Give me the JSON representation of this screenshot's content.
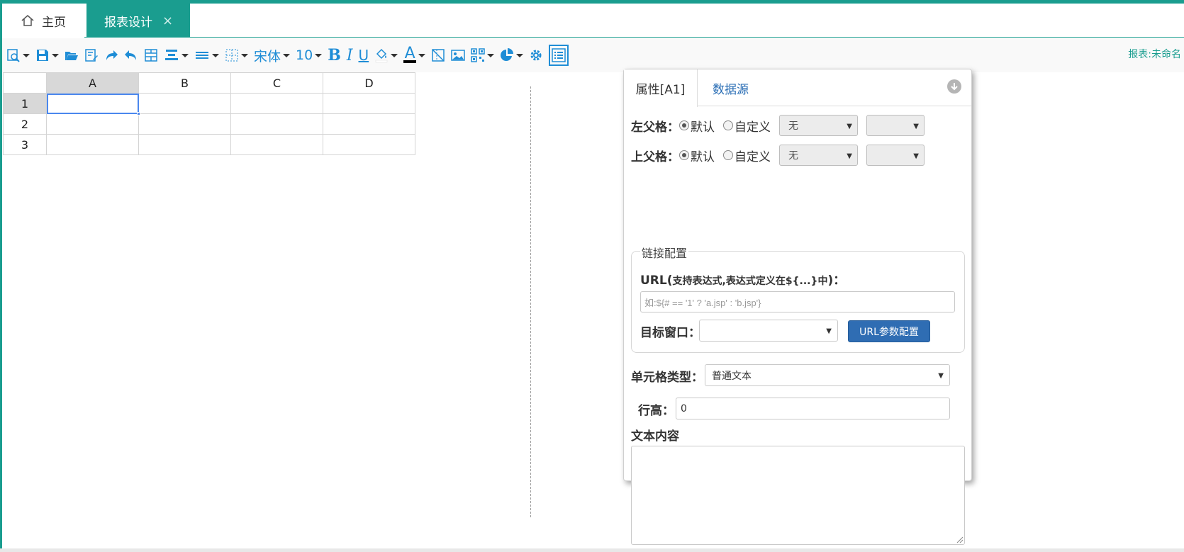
{
  "tabs": {
    "home": "主页",
    "design": "报表设计",
    "close": "×"
  },
  "toolbar": {
    "font_name": "宋体",
    "font_size": "10",
    "bold": "B",
    "italic": "I",
    "underline": "U",
    "font_color_letter": "A",
    "report_name": "报表:未命名",
    "accent_color": "#1f8dd6"
  },
  "sheet": {
    "columns": [
      "A",
      "B",
      "C",
      "D"
    ],
    "rows": [
      "1",
      "2",
      "3"
    ],
    "selected_cell": "A1"
  },
  "panel": {
    "tabs": {
      "attributes": "属性[A1]",
      "datasource": "数据源"
    },
    "left_parent": {
      "label": "左父格：",
      "default": "默认",
      "custom": "自定义",
      "select_value": "无"
    },
    "top_parent": {
      "label": "上父格：",
      "default": "默认",
      "custom": "自定义",
      "select_value": "无"
    },
    "link_config": {
      "legend": "链接配置",
      "url_label": "URL(",
      "url_hint": "支持表达式,表达式定义在${...}中",
      "url_label_end": ")：",
      "url_placeholder": "如:${# == '1' ? 'a.jsp' : 'b.jsp'}",
      "target_label": "目标窗口：",
      "url_param_button": "URL参数配置"
    },
    "cell_type": {
      "label": "单元格类型：",
      "value": "普通文本"
    },
    "row_height": {
      "label": "行高：",
      "value": "0"
    },
    "text_content": {
      "label": "文本内容"
    }
  },
  "colors": {
    "theme": "#1a9d8f",
    "button_blue": "#2f6db3"
  }
}
